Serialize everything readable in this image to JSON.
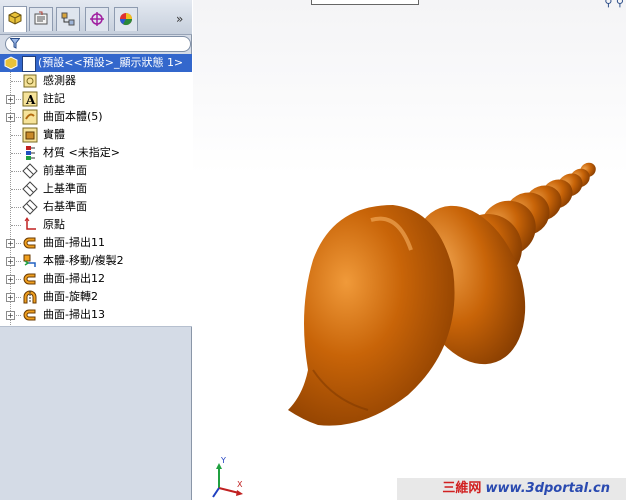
{
  "feature_tree": {
    "root_label": "(預設<<預設>_顯示狀態 1>",
    "items": [
      {
        "label": "感測器",
        "icon": "sensor-icon",
        "expandable": false
      },
      {
        "label": "註記",
        "icon": "annotation-icon",
        "expandable": true
      },
      {
        "label": "曲面本體(5)",
        "icon": "surface-bodies-icon",
        "expandable": true
      },
      {
        "label": "實體",
        "icon": "solid-bodies-icon",
        "expandable": false
      },
      {
        "label": "材質 <未指定>",
        "icon": "material-icon",
        "expandable": false
      },
      {
        "label": "前基準面",
        "icon": "plane-icon",
        "expandable": false
      },
      {
        "label": "上基準面",
        "icon": "plane-icon",
        "expandable": false
      },
      {
        "label": "右基準面",
        "icon": "plane-icon",
        "expandable": false
      },
      {
        "label": "原點",
        "icon": "origin-icon",
        "expandable": false
      },
      {
        "label": "曲面-掃出11",
        "icon": "surface-sweep-icon",
        "expandable": true
      },
      {
        "label": "本體-移動/複製2",
        "icon": "move-copy-body-icon",
        "expandable": true
      },
      {
        "label": "曲面-掃出12",
        "icon": "surface-sweep-icon",
        "expandable": true
      },
      {
        "label": "曲面-旋轉2",
        "icon": "surface-revolve-icon",
        "expandable": true
      },
      {
        "label": "曲面-掃出13",
        "icon": "surface-sweep-icon",
        "expandable": true
      }
    ]
  },
  "tabs": [
    {
      "name": "FeatureManager",
      "icon": "feature-manager-icon",
      "active": true
    },
    {
      "name": "PropertyManager",
      "icon": "property-manager-icon",
      "active": false
    },
    {
      "name": "ConfigurationManager",
      "icon": "configuration-manager-icon",
      "active": false
    },
    {
      "name": "DimXpert",
      "icon": "dimxpert-icon",
      "active": false
    },
    {
      "name": "Display",
      "icon": "display-manager-icon",
      "active": false
    }
  ],
  "more_tabs_glyph": "»",
  "triad": {
    "y_label": "Y",
    "x_label": "X"
  },
  "watermark": {
    "chinese": "三維网",
    "url": "www.3dportal.cn"
  },
  "colors": {
    "shell": "#c86408",
    "selection": "#3367cc",
    "panel": "#d4dbe6"
  }
}
